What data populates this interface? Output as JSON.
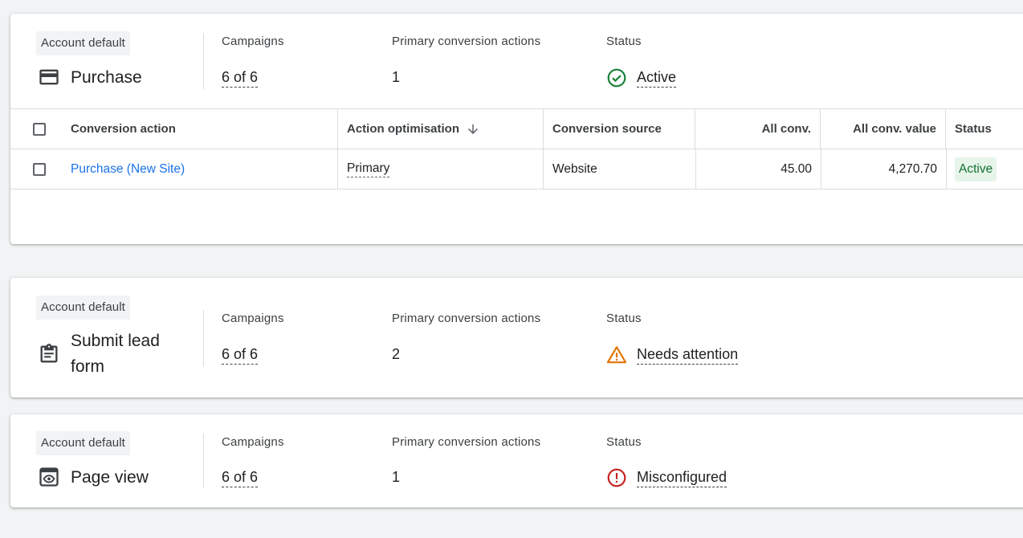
{
  "goals": [
    {
      "badge": "Account default",
      "name": "Purchase",
      "icon": "credit-card-icon",
      "campaigns_label": "Campaigns",
      "campaigns_value": "6 of 6",
      "primary_label": "Primary conversion actions",
      "primary_value": "1",
      "status_label": "Status",
      "status_value": "Active",
      "status_icon": "check-circle-icon",
      "status_color": "#188038"
    },
    {
      "badge": "Account default",
      "name_line1": "Submit lead",
      "name_line2": "form",
      "icon": "clipboard-icon",
      "campaigns_label": "Campaigns",
      "campaigns_value": "6 of 6",
      "primary_label": "Primary conversion actions",
      "primary_value": "2",
      "status_label": "Status",
      "status_value": "Needs attention",
      "status_icon": "warning-icon",
      "status_color": "#e37400"
    },
    {
      "badge": "Account default",
      "name": "Page view",
      "icon": "browser-eye-icon",
      "campaigns_label": "Campaigns",
      "campaigns_value": "6 of 6",
      "primary_label": "Primary conversion actions",
      "primary_value": "1",
      "status_label": "Status",
      "status_value": "Misconfigured",
      "status_icon": "error-circle-icon",
      "status_color": "#c5221f"
    }
  ],
  "table": {
    "headers": {
      "conversion_action": "Conversion action",
      "action_optimisation": "Action optimisation",
      "conversion_source": "Conversion source",
      "all_conv": "All conv.",
      "all_conv_value": "All conv. value",
      "status": "Status"
    },
    "sort_icon": "arrow-down-icon",
    "rows": [
      {
        "conversion_action": "Purchase (New Site)",
        "action_optimisation": "Primary",
        "conversion_source": "Website",
        "all_conv": "45.00",
        "all_conv_value": "4,270.70",
        "status": "Active"
      }
    ]
  },
  "colors": {
    "link": "#1a73e8",
    "active_chip_bg": "#e6f4ea",
    "active_chip_text": "#137333"
  }
}
